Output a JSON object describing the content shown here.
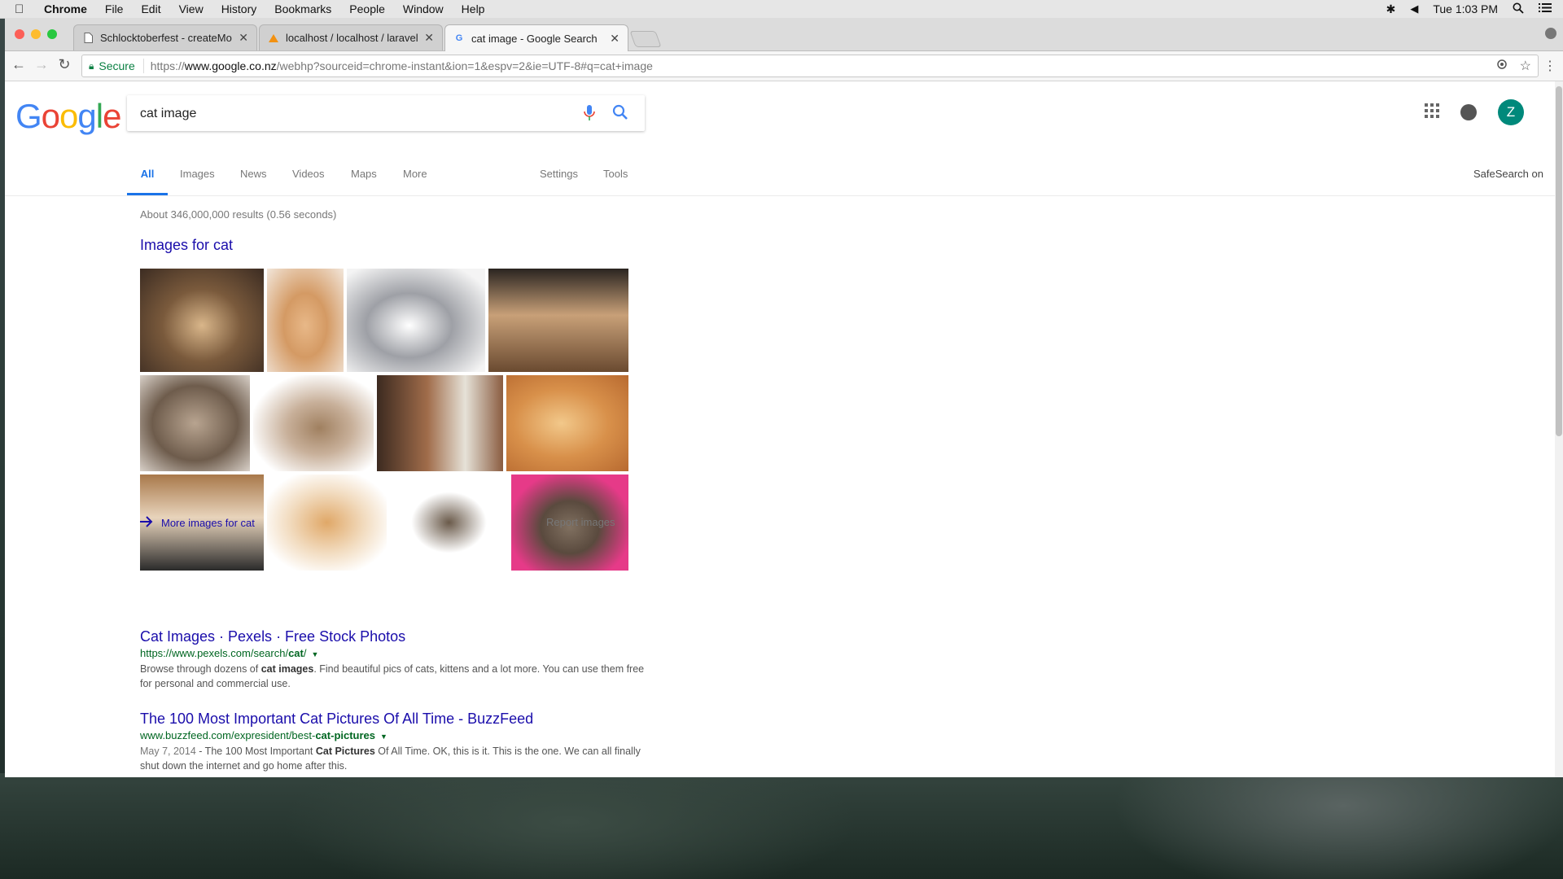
{
  "menubar": {
    "app": "Chrome",
    "items": [
      "File",
      "Edit",
      "View",
      "History",
      "Bookmarks",
      "People",
      "Window",
      "Help"
    ],
    "clock": "Tue 1:03 PM"
  },
  "tabs": [
    {
      "title": "Schlocktoberfest - createMov",
      "active": false
    },
    {
      "title": "localhost / localhost / laravel_s",
      "active": false
    },
    {
      "title": "cat image - Google Search",
      "active": true
    }
  ],
  "omnibox": {
    "secure_label": "Secure",
    "url_scheme": "https://",
    "url_host": "www.google.co.nz",
    "url_rest": "/webhp?sourceid=chrome-instant&ion=1&espv=2&ie=UTF-8#q=cat+image"
  },
  "google": {
    "logo": "Google",
    "query": "cat image",
    "avatar_letter": "Z",
    "tabs": [
      "All",
      "Images",
      "News",
      "Videos",
      "Maps",
      "More",
      "Settings",
      "Tools"
    ],
    "safesearch": "SafeSearch on",
    "stats": "About 346,000,000 results (0.56 seconds)",
    "images_heading": "Images for cat",
    "more_images": "More images for cat",
    "report_images": "Report images"
  },
  "results": [
    {
      "title": "Cat Images · Pexels · Free Stock Photos",
      "url_pre": "https://www.pexels.com/search/",
      "url_bold": "cat",
      "url_post": "/",
      "snippet_parts": [
        "Browse through dozens of ",
        "cat images",
        ". Find beautiful pics of cats, kittens and a lot more. You can use them free for personal and commercial use."
      ]
    },
    {
      "title": "The 100 Most Important Cat Pictures Of All Time - BuzzFeed",
      "url_pre": "www.buzzfeed.com/expresident/best-",
      "url_bold": "cat-pictures",
      "url_post": "",
      "date": "May 7, 2014",
      "snippet_parts": [
        " - The 100 Most Important ",
        "Cat Pictures",
        " Of All Time. OK, this is it. This is the one. We can all finally shut down the internet and go home after this."
      ]
    }
  ],
  "colors": {
    "google_blue": "#4285F4",
    "google_red": "#EA4335",
    "google_yellow": "#FBBC05",
    "google_green": "#34A853",
    "link": "#1a0dab",
    "url_green": "#006621",
    "avatar": "#00897b"
  }
}
